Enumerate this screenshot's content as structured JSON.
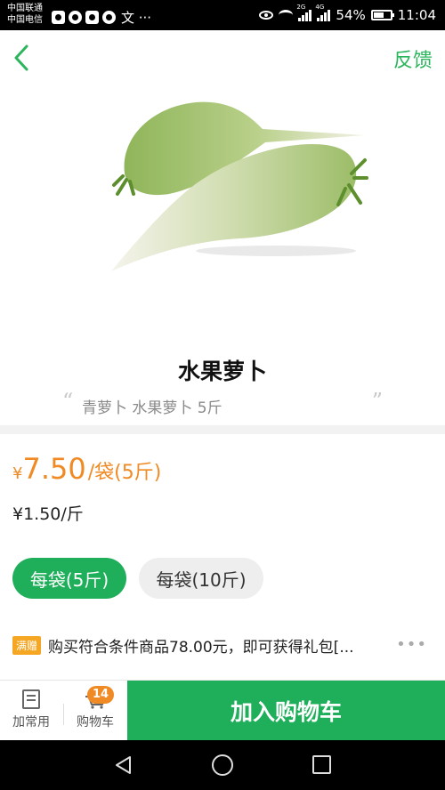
{
  "status_bar": {
    "carrier_1": "中国联通",
    "carrier_2": "中国电信",
    "extra_text": "文 ···",
    "net_1": "2G",
    "net_2": "4G",
    "battery": "54%",
    "time": "11:04"
  },
  "header": {
    "feedback_label": "反馈"
  },
  "product": {
    "title": "水果萝卜",
    "subtitle": "青萝卜 水果萝卜 5斤",
    "price_currency": "¥",
    "price_value": "7.50",
    "price_unit": "/袋(5斤)",
    "unit_price": "¥1.50/斤"
  },
  "specs": [
    {
      "label": "每袋(5斤)",
      "selected": true
    },
    {
      "label": "每袋(10斤)",
      "selected": false
    }
  ],
  "promo": {
    "tag": "满赠",
    "text": "购买符合条件商品78.00元，即可获得礼包[..."
  },
  "bottom_bar": {
    "fav_label": "加常用",
    "cart_label": "购物车",
    "cart_count": "14",
    "add_to_cart_label": "加入购物车"
  },
  "colors": {
    "accent_green": "#1fae5a",
    "price_orange": "#f08a24"
  }
}
